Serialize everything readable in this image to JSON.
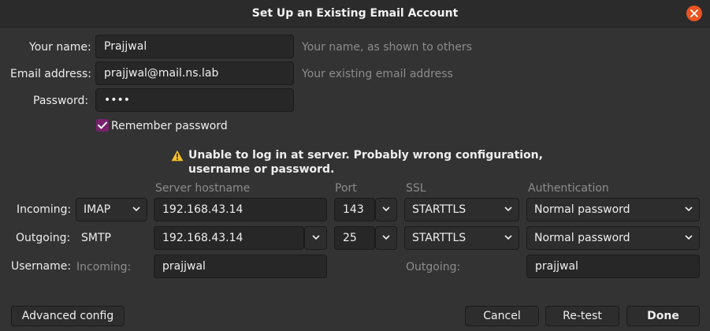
{
  "window": {
    "title": "Set Up an Existing Email Account"
  },
  "form": {
    "name_label": "Your name:",
    "name_value": "Prajjwal",
    "name_hint": "Your name, as shown to others",
    "email_label": "Email address:",
    "email_value": "prajjwal@mail.ns.lab",
    "email_hint": "Your existing email address",
    "password_label": "Password:",
    "password_value": "••••",
    "remember_label": "Remember password",
    "remember_checked": true
  },
  "warning": {
    "line1": "Unable to log in at server. Probably wrong configuration,",
    "line2": "username or password."
  },
  "server_table": {
    "headers": {
      "hostname": "Server hostname",
      "port": "Port",
      "ssl": "SSL",
      "auth": "Authentication"
    },
    "incoming": {
      "label": "Incoming:",
      "protocol": "IMAP",
      "hostname": "192.168.43.14",
      "port": "143",
      "ssl": "STARTTLS",
      "auth": "Normal password"
    },
    "outgoing": {
      "label": "Outgoing:",
      "protocol": "SMTP",
      "hostname": "192.168.43.14",
      "port": "25",
      "ssl": "STARTTLS",
      "auth": "Normal password"
    },
    "username": {
      "label": "Username:",
      "incoming_label": "Incoming:",
      "incoming_value": "prajjwal",
      "outgoing_label": "Outgoing:",
      "outgoing_value": "prajjwal"
    }
  },
  "buttons": {
    "advanced": "Advanced config",
    "cancel": "Cancel",
    "retest": "Re-test",
    "done": "Done"
  },
  "colors": {
    "accent": "#e95420",
    "checkbox": "#77216f",
    "warning_icon": "#f6c026",
    "background": "#333333"
  },
  "icons": {
    "close": "close-icon",
    "warning": "warning-icon",
    "check": "checkmark-icon",
    "chevron": "chevron-down-icon"
  }
}
